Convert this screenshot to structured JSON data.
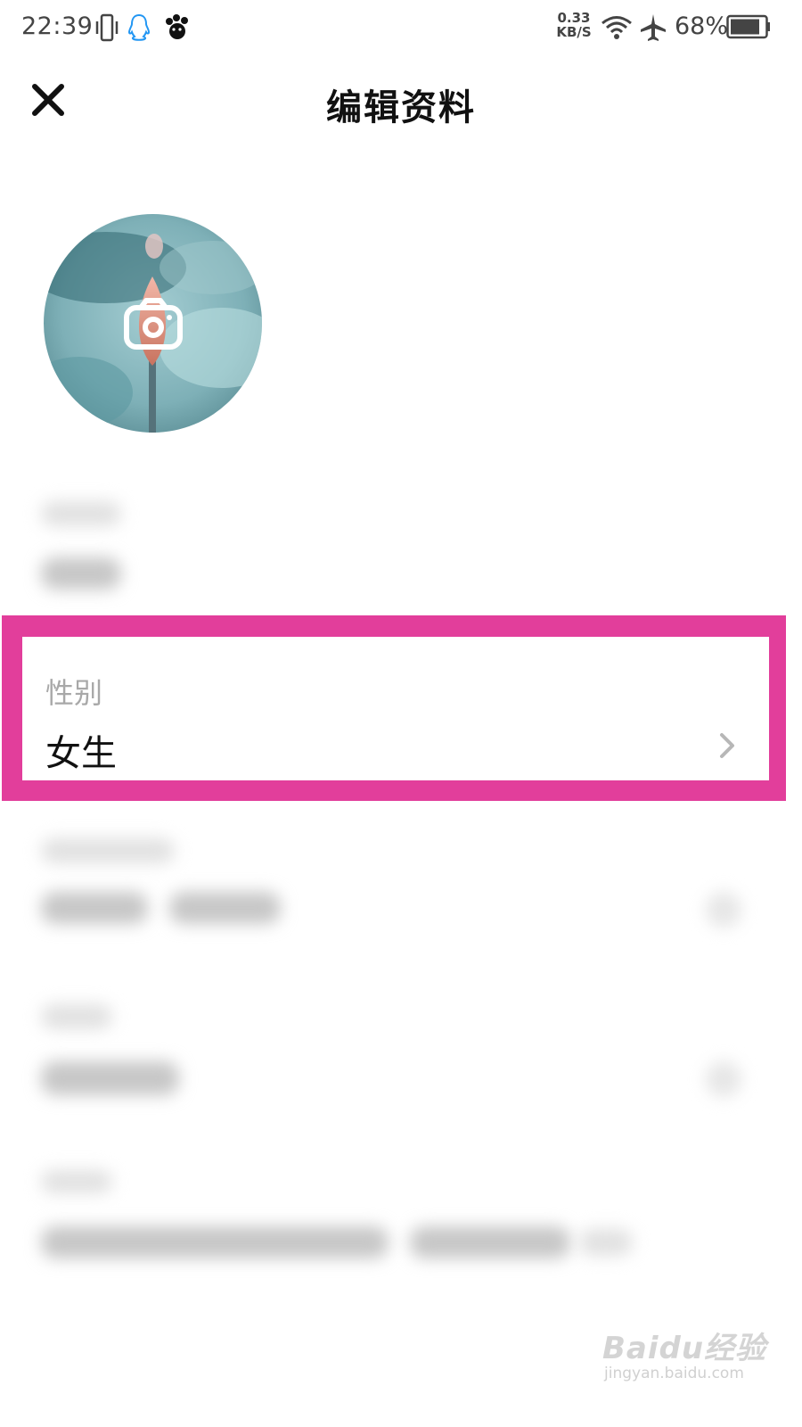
{
  "status_bar": {
    "time": "22:39",
    "speed_value": "0.33",
    "speed_unit": "KB/S",
    "battery": "68%",
    "icons": [
      "vibrate-icon",
      "qq-icon",
      "paw-icon",
      "wifi-icon",
      "airplane-icon",
      "battery-icon"
    ]
  },
  "header": {
    "title": "编辑资料",
    "close_icon": "close-icon"
  },
  "avatar": {
    "icon": "camera-icon"
  },
  "gender": {
    "label": "性别",
    "value": "女生",
    "icon": "chevron-right-icon"
  },
  "colors": {
    "highlight": "#e23e9b",
    "label_gray": "#a8a8a8",
    "text": "#111111"
  },
  "watermark": {
    "brand": "Baidu经验",
    "url": "jingyan.baidu.com"
  }
}
